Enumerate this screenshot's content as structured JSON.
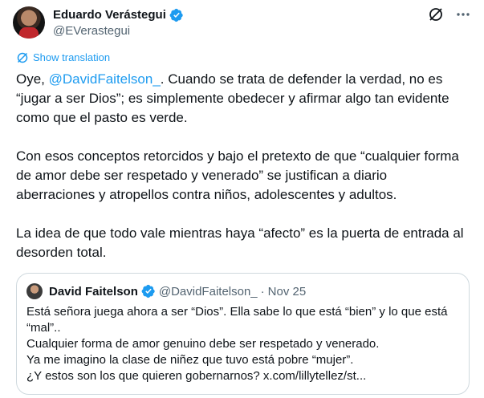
{
  "author": {
    "name": "Eduardo Verástegui",
    "handle": "@EVerastegui"
  },
  "icons": {
    "verified": "verified-badge-icon",
    "grok": "grok-icon",
    "more": "more-icon",
    "translate": "translate-icon"
  },
  "colors": {
    "accent": "#1d9bf0",
    "text": "#0f1419",
    "secondary": "#536471",
    "border": "#cfd9de"
  },
  "translate_label": "Show translation",
  "tweet": {
    "p1_pre": "Oye, ",
    "p1_mention": "@DavidFaitelson_",
    "p1_post": ". Cuando se trata de defender la verdad, no es “jugar a ser Dios”; es simplemente obedecer y afirmar algo tan evidente como que el pasto es verde.",
    "p2": "Con esos conceptos retorcidos y bajo el pretexto de que “cualquier forma de amor debe ser respetado y venerado” se justifican a diario aberraciones y atropellos contra niños, adolescentes y adultos.",
    "p3": "La idea de que todo vale mientras haya “afecto” es la puerta de entrada al desorden total."
  },
  "quote": {
    "name": "David Faitelson",
    "handle": "@DavidFaitelson_",
    "separator": "·",
    "date": "Nov 25",
    "lines": [
      "Está señora juega ahora a ser “Dios”. Ella sabe lo que está “bien” y lo que está “mal”..",
      "Cualquier forma de amor genuino debe ser respetado y venerado.",
      "Ya me imagino la clase de niñez que tuvo está pobre “mujer”.",
      "¿Y estos son los que quieren gobernarnos? x.com/lillytellez/st..."
    ]
  }
}
